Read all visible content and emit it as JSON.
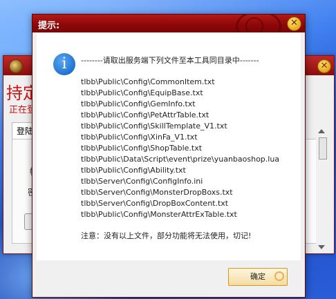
{
  "background_window": {
    "big_text": "持定",
    "status_text": "正在登",
    "tab_label": "登陆",
    "label_1": "帐",
    "label_2": "密"
  },
  "dialog": {
    "title": "提示:",
    "close_glyph": "✕",
    "info_icon_glyph": "i",
    "header": "--------请取出服务端下列文件至本工具同目录中-------",
    "files": [
      "tlbb\\Public\\Config\\CommonItem.txt",
      "tlbb\\Public\\Config\\EquipBase.txt",
      "tlbb\\Public\\Config\\GemInfo.txt",
      "tlbb\\Public\\Config\\PetAttrTable.txt",
      "tlbb\\Public\\Config\\SkillTemplate_V1.txt",
      "tlbb\\Public\\Config\\XinFa_V1.txt",
      "tlbb\\Public\\Config\\ShopTable.txt",
      "tlbb\\Public\\Data\\Script\\event\\prize\\yuanbaoshop.lua",
      "tlbb\\Public\\Config\\Ability.txt",
      "tlbb\\Server\\Config\\ConfigInfo.ini",
      "tlbb\\Server\\Config\\MonsterDropBoxs.txt",
      "tlbb\\Server\\Config\\DropBoxContent.txt",
      "tlbb\\Public\\Config\\MonsterAttrExTable.txt"
    ],
    "footer": "注意：没有以上文件，部分功能将无法使用，切记!",
    "ok_label": "确定"
  },
  "colors": {
    "titlebar": "#8c0707",
    "info_icon": "#1c6fd0",
    "button_border": "#d8961c"
  }
}
